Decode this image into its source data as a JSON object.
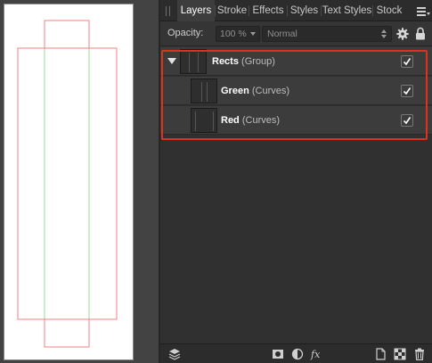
{
  "tabs": [
    {
      "label": "Layers",
      "active": true
    },
    {
      "label": "Stroke",
      "active": false
    },
    {
      "label": "Effects",
      "active": false
    },
    {
      "label": "Styles",
      "active": false
    },
    {
      "label": "Text Styles",
      "active": false
    },
    {
      "label": "Stock",
      "active": false
    }
  ],
  "options": {
    "opacity_label": "Opacity:",
    "opacity_value": "100 %",
    "blend_mode": "Normal"
  },
  "layers": [
    {
      "name": "Rects",
      "type": "(Group)",
      "visible": true,
      "expanded": true
    },
    {
      "name": "Green",
      "type": "(Curves)",
      "visible": true
    },
    {
      "name": "Red",
      "type": "(Curves)",
      "visible": true
    }
  ],
  "colors": {
    "highlight": "#e0311f",
    "red_curve": "#f08080",
    "green_curve": "#8fe08f"
  },
  "icons": {
    "menu": "hamburger-menu-icon",
    "settings": "gear-icon",
    "lock": "lock-icon",
    "layers": "layers-stack-icon",
    "mask": "mask-icon",
    "adjustment": "adjustment-icon",
    "fx": "fx-icon",
    "new_layer": "new-layer-icon",
    "new_group": "group-icon",
    "delete": "trash-icon"
  }
}
